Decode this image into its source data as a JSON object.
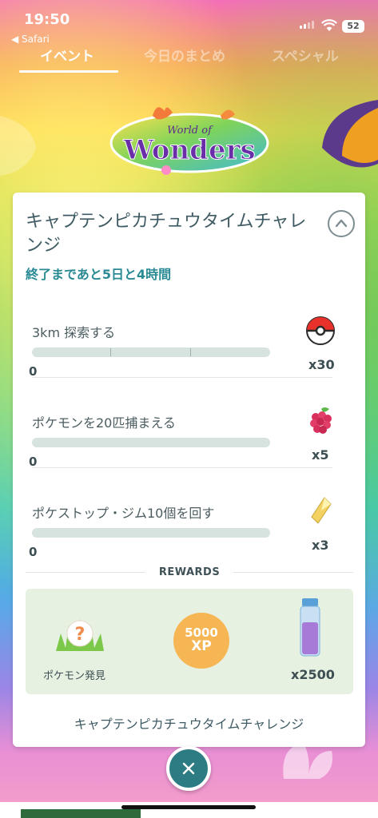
{
  "status_bar": {
    "time": "19:50",
    "back_app": "◀ Safari",
    "battery": "52"
  },
  "tabs": [
    {
      "label": "イベント",
      "active": true
    },
    {
      "label": "今日のまとめ",
      "active": false
    },
    {
      "label": "スペシャル",
      "active": false
    }
  ],
  "logo": {
    "line1": "World of",
    "line2": "Wonders"
  },
  "card": {
    "title": "キャプテンピカチュウタイムチャレンジ",
    "time_left": "終了まであと5日と4時間",
    "tasks": [
      {
        "label": "3km 探索する",
        "progress": "0",
        "reward_icon": "poke-ball-icon",
        "reward_count": "x30"
      },
      {
        "label": "ポケモンを20匹捕まえる",
        "progress": "0",
        "reward_icon": "razz-berry-icon",
        "reward_count": "x5"
      },
      {
        "label": "ポケストップ・ジム10個を回す",
        "progress": "0",
        "reward_icon": "stardust-icon",
        "reward_count": "x3"
      }
    ],
    "rewards_heading": "REWARDS",
    "rewards": [
      {
        "icon": "mystery-pokemon-icon",
        "label": "ポケモン発見"
      },
      {
        "icon": "xp-badge",
        "value": "5000",
        "unit": "XP"
      },
      {
        "icon": "potion-icon",
        "count": "x2500"
      }
    ],
    "footer_title": "キャプテンピカチュウタイムチャレンジ"
  },
  "colors": {
    "accent": "#2a8a94",
    "close_button": "#2d7c83",
    "xp": "#f5b653",
    "rewards_bg": "#e6f1e2"
  }
}
